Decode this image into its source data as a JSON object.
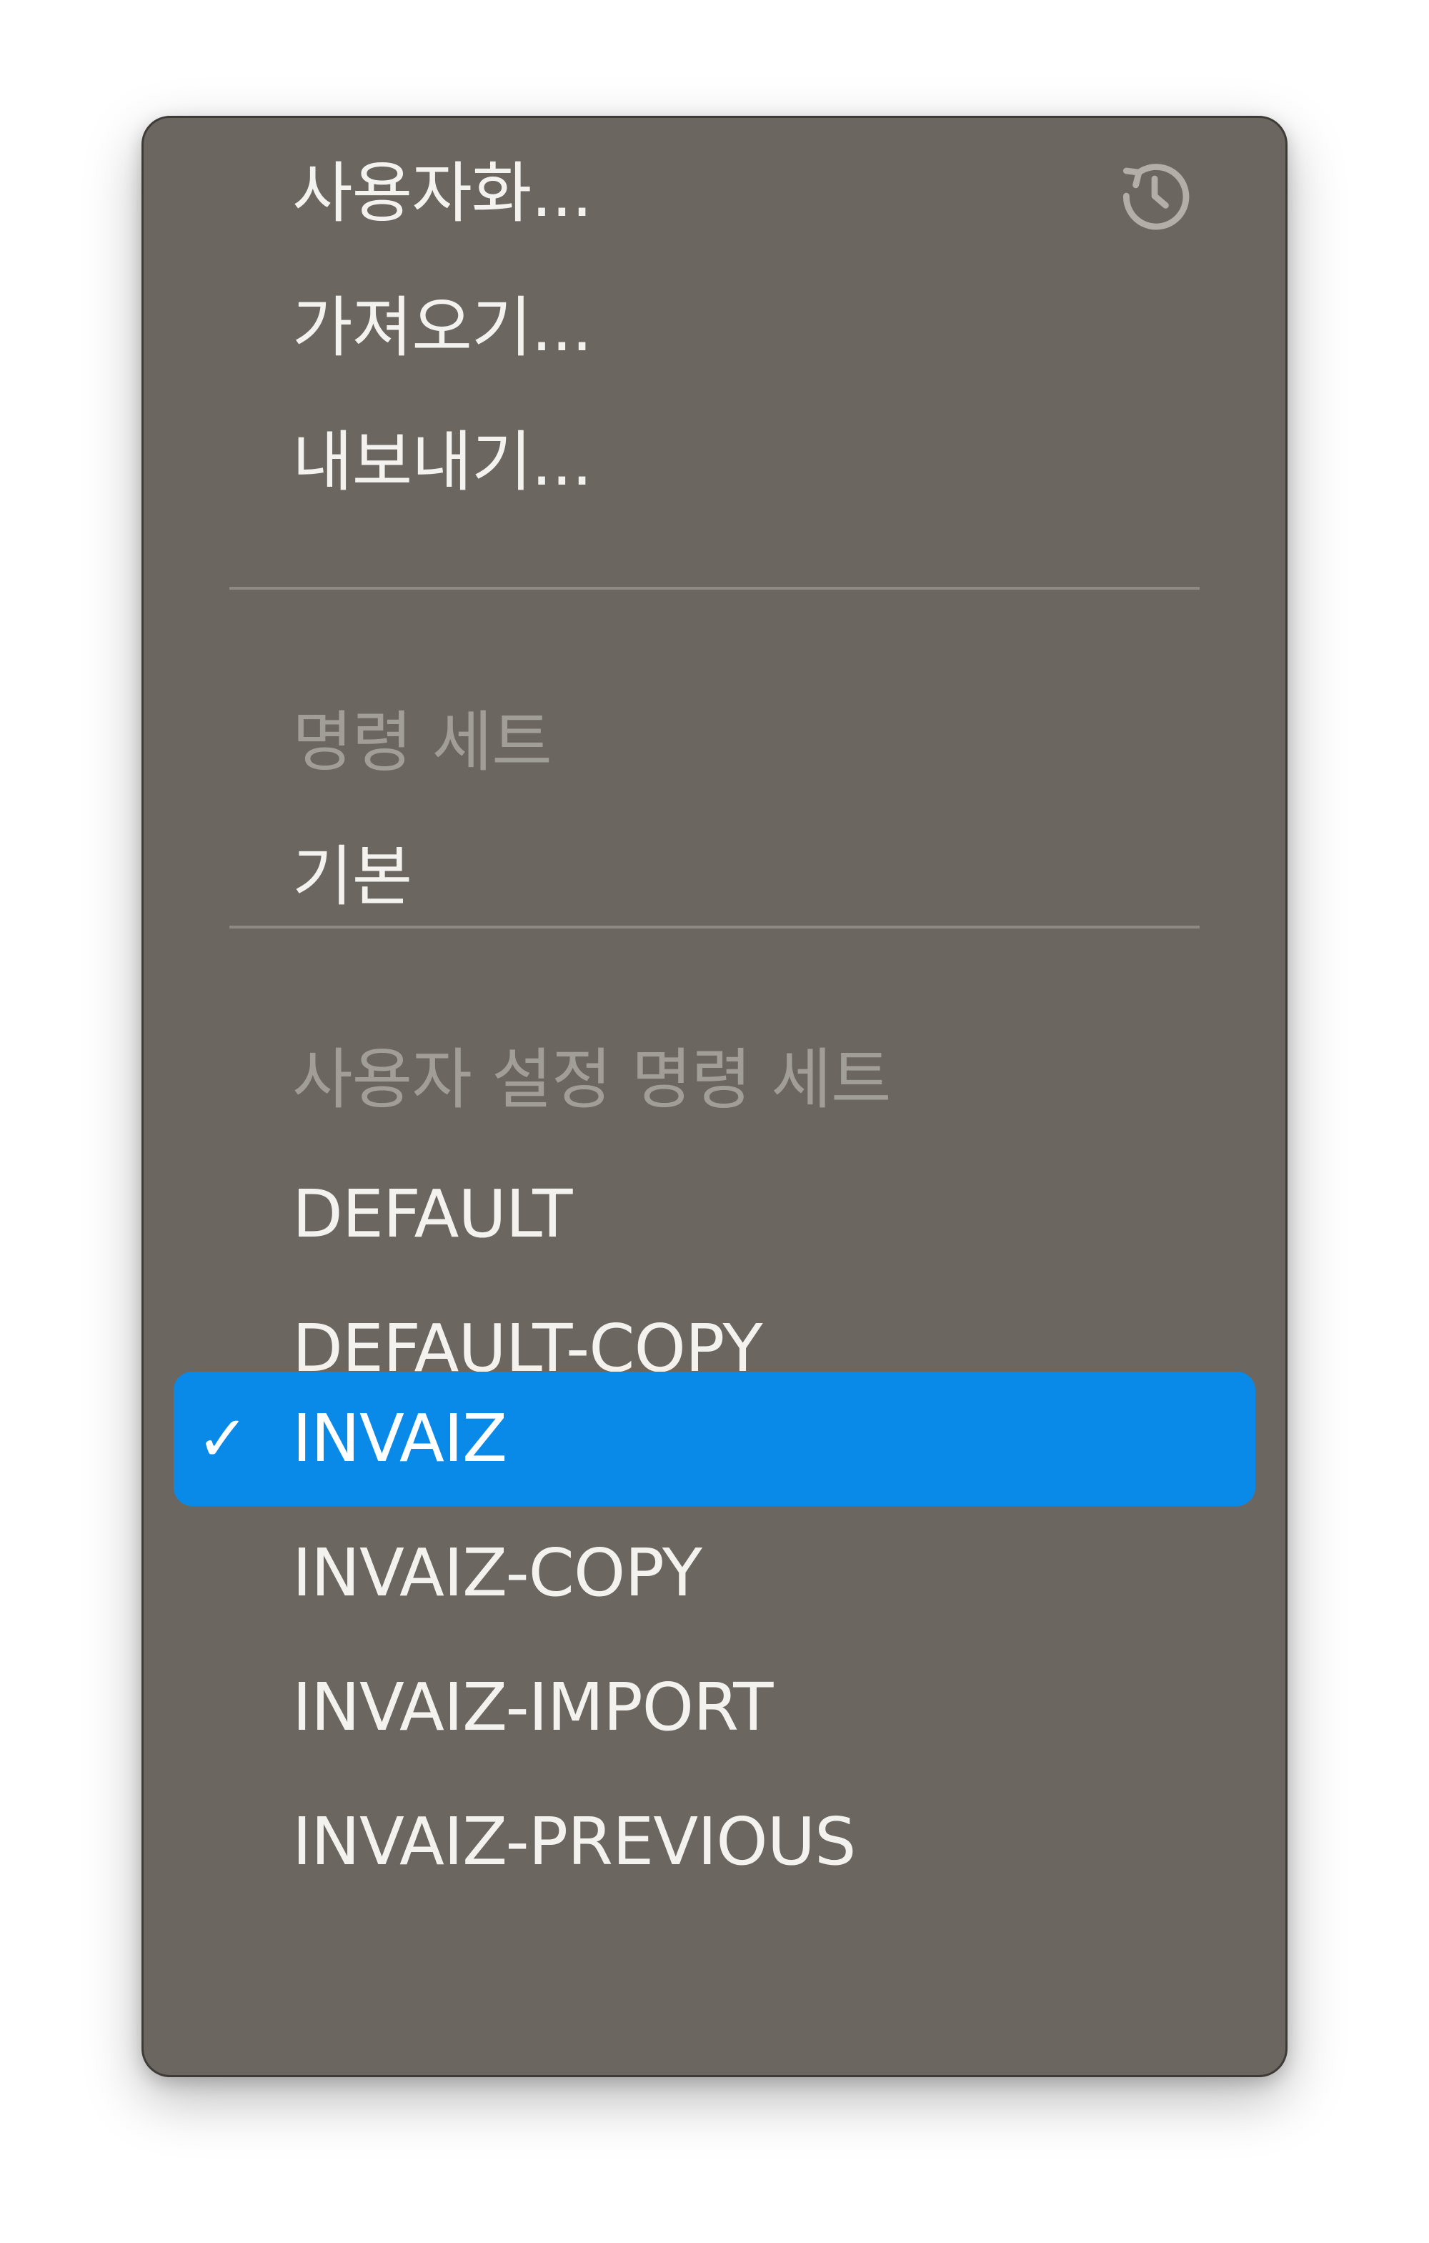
{
  "menu": {
    "actions": [
      {
        "label": "사용자화..."
      },
      {
        "label": "가져오기..."
      },
      {
        "label": "내보내기..."
      }
    ],
    "reset_icon": "reset-history-icon",
    "command_sets_header": "명령 세트",
    "command_sets": [
      {
        "label": "기본"
      }
    ],
    "custom_sets_header": "사용자 설정 명령 세트",
    "custom_sets": [
      {
        "label": "DEFAULT",
        "checked": false
      },
      {
        "label": "DEFAULT-COPY",
        "checked": false
      },
      {
        "label": "INVAIZ",
        "checked": true
      },
      {
        "label": "INVAIZ-COPY",
        "checked": false
      },
      {
        "label": "INVAIZ-IMPORT",
        "checked": false
      },
      {
        "label": "INVAIZ-PREVIOUS",
        "checked": false
      }
    ],
    "checkmark": "✓",
    "colors": {
      "background": "#6b6660",
      "highlight": "#0a8ae8",
      "text": "#f4f2ef",
      "header_text": "#a19d97"
    }
  }
}
